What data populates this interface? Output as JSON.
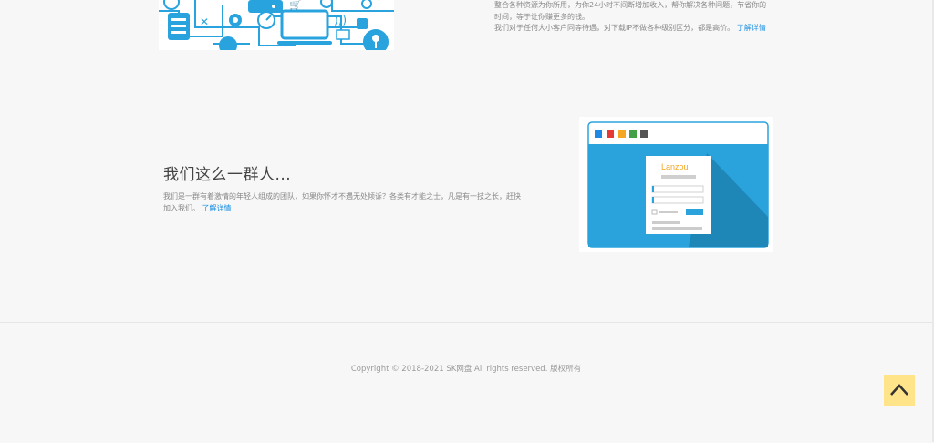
{
  "services": {
    "line1": "整合各种资源为你所用，为你24小时不间断增加收入，帮你解决各种问题，节省你的时间，等于让你赚更多的钱。",
    "line2": "我们对于任何大小客户同等待遇，对下载IP不做各种级别区分，都是高价。",
    "more_link": "了解详情"
  },
  "team": {
    "title": "我们这么一群人...",
    "description": "我们是一群有着激情的年轻人组成的团队，如果你怀才不遇无处倾诉？各类有才能之士，凡是有一技之长，赶快加入我们。",
    "more_link": "了解详情"
  },
  "illustration": {
    "brand": "Lanzou",
    "dot_colors": [
      "#1e88e5",
      "#e53935",
      "#f5a623",
      "#43a047",
      "#555555"
    ],
    "accent": "#2aa3dd"
  },
  "footer": {
    "copyright": "Copyright © 2018-2021 SK网盘 All rights reserved. 版权所有"
  },
  "colors": {
    "link": "#1a8fe3",
    "back_to_top_bg": "#ffe489",
    "icon_blue": "#29a3dd"
  }
}
